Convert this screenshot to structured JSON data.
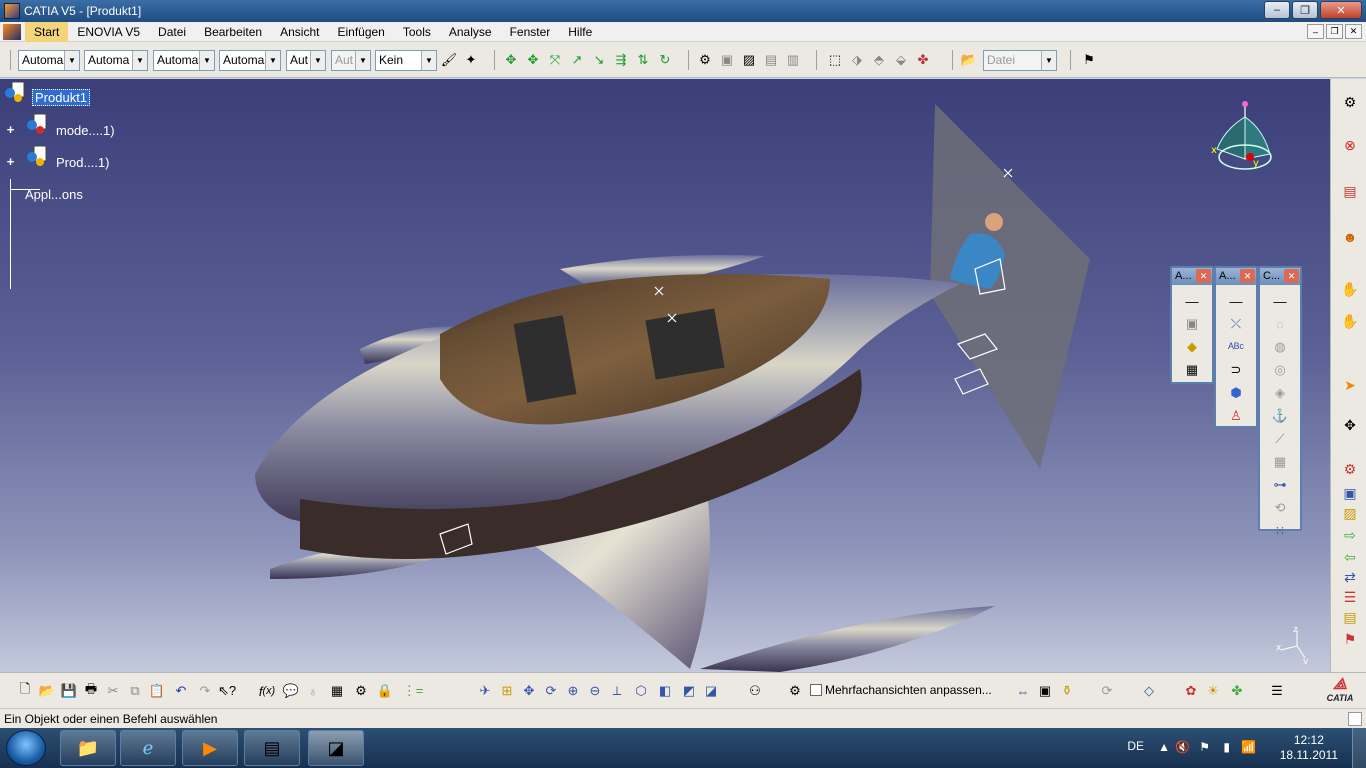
{
  "window": {
    "title": "CATIA V5 - [Produkt1]",
    "minimize": "–",
    "maximize": "❐",
    "close": "✕"
  },
  "menubar": {
    "items": [
      {
        "label": "Start",
        "active": true
      },
      {
        "label": "ENOVIA V5"
      },
      {
        "label": "Datei"
      },
      {
        "label": "Bearbeiten"
      },
      {
        "label": "Ansicht"
      },
      {
        "label": "Einfügen"
      },
      {
        "label": "Tools"
      },
      {
        "label": "Analyse"
      },
      {
        "label": "Fenster"
      },
      {
        "label": "Hilfe"
      }
    ],
    "doc_minimize": "–",
    "doc_restore": "❐",
    "doc_close": "✕"
  },
  "toolbar_top": {
    "combos": [
      {
        "value": "Automa"
      },
      {
        "value": "Automa"
      },
      {
        "value": "Automa"
      },
      {
        "value": "Automa"
      },
      {
        "value": "Aut"
      },
      {
        "value": "Aut",
        "disabled": true
      },
      {
        "value": "Kein"
      },
      {
        "value": "Datei",
        "disabled": true
      }
    ]
  },
  "tree": {
    "root": "Produkt1",
    "children": [
      {
        "label": "mode....1)"
      },
      {
        "label": "Prod....1)"
      },
      {
        "label": "Appl...ons"
      }
    ]
  },
  "palettes": [
    {
      "title": "A..."
    },
    {
      "title": "A..."
    },
    {
      "title": "C..."
    }
  ],
  "compass": {
    "x_label": "x",
    "y_label": "y"
  },
  "axis_triad": {
    "z": "z",
    "x": "x",
    "y": "y"
  },
  "toolbar_bottom": {
    "checkbox_label": "Mehrfachansichten anpassen..."
  },
  "statusbar": {
    "message": "Ein Objekt oder einen Befehl auswählen"
  },
  "catia_brand": "CATIA",
  "taskbar": {
    "language": "DE",
    "time": "12:12",
    "date": "18.11.2011"
  }
}
